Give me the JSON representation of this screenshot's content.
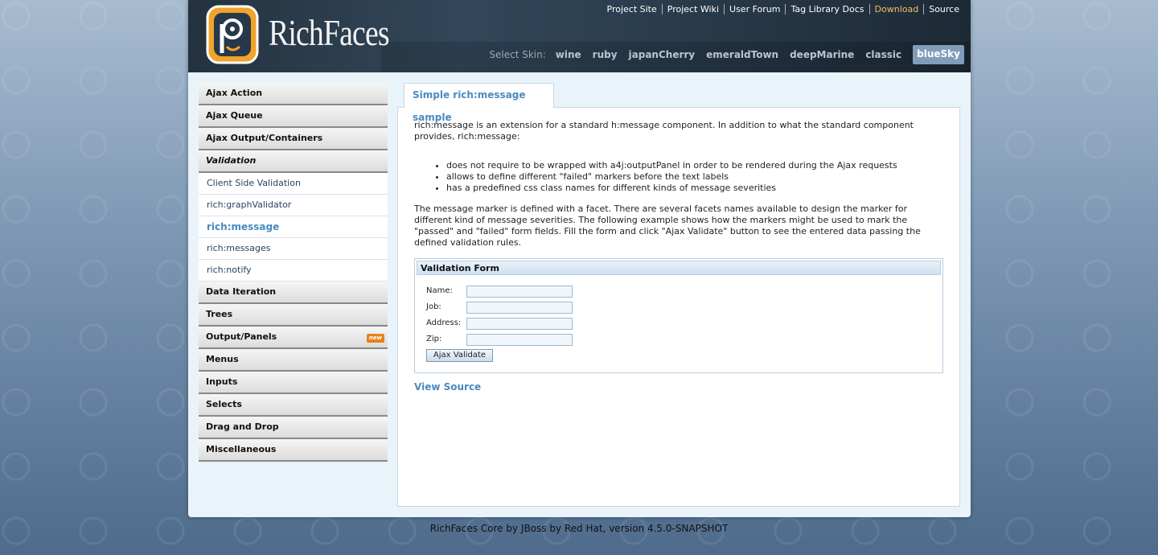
{
  "header": {
    "logo_text": "RichFaces",
    "top_links": [
      "Project Site",
      "Project Wiki",
      "User Forum",
      "Tag Library Docs",
      "Download",
      "Source"
    ],
    "skin_label": "Select Skin:",
    "skins": [
      "wine",
      "ruby",
      "japanCherry",
      "emeraldTown",
      "deepMarine",
      "classic",
      "blueSky"
    ],
    "selected_skin": "blueSky"
  },
  "sidebar": {
    "groups_top": [
      "Ajax Action",
      "Ajax Queue",
      "Ajax Output/Containers"
    ],
    "open_group": "Validation",
    "open_items": [
      "Client Side Validation",
      "rich:graphValidator",
      "rich:message",
      "rich:messages",
      "rich:notify"
    ],
    "active_item": "rich:message",
    "groups_bottom": [
      "Data Iteration",
      "Trees",
      "Output/Panels",
      "Menus",
      "Inputs",
      "Selects",
      "Drag and Drop",
      "Miscellaneous"
    ],
    "new_badge": "new"
  },
  "tab": {
    "label": "Simple rich:message sample"
  },
  "content": {
    "intro": "rich:message is an extension for a standard h:message component. In addition to what the standard component provides, rich:message:",
    "bullets": [
      "does not require to be wrapped with a4j:outputPanel in order to be rendered during the Ajax requests",
      "allows to define different \"failed\" markers before the text labels",
      "has a predefined css class names for different kinds of message severities"
    ],
    "para2": "The message marker is defined with a facet. There are several facets names available to design the marker for different kind of message severities. The following example shows how the markers might be used to mark the \"passed\" and \"failed\" form fields. Fill the form and click \"Ajax Validate\" button to see the entered data passing the defined validation rules.",
    "form": {
      "title": "Validation Form",
      "fields": [
        {
          "label": "Name:",
          "value": ""
        },
        {
          "label": "Job:",
          "value": ""
        },
        {
          "label": "Address:",
          "value": ""
        },
        {
          "label": "Zip:",
          "value": ""
        }
      ],
      "button_label": "Ajax Validate"
    },
    "view_source": "View Source"
  },
  "footer": {
    "text": "RichFaces Core by JBoss by Red Hat, version 4.5.0-SNAPSHOT"
  }
}
